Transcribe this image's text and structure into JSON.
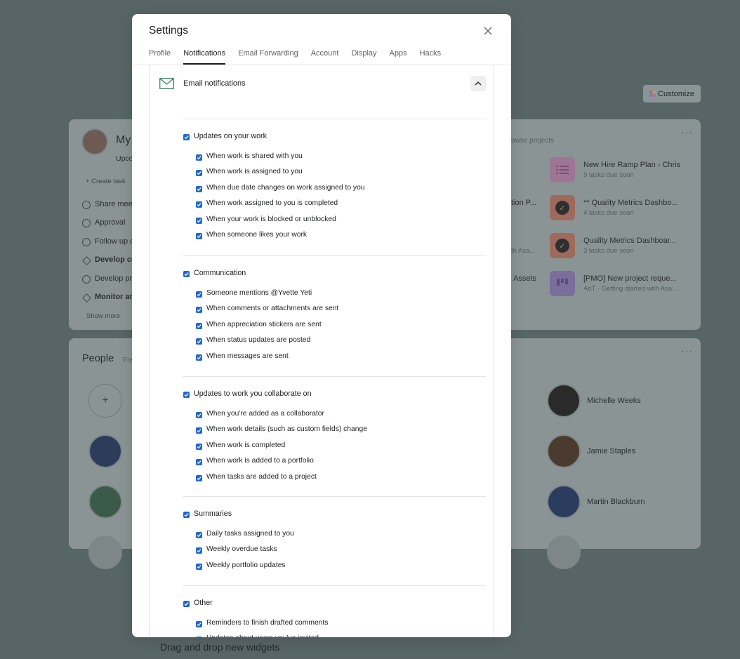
{
  "background": {
    "customize_label": "Customize",
    "my_title": "My",
    "my_tab": "Upco",
    "create_task": "Create task",
    "tasks": [
      "Share mee",
      "Approval",
      "Follow up c",
      "Develop co",
      "Develop pr",
      "Monitor an"
    ],
    "show_more": "Show more",
    "browse_projects": "owse projects",
    "projects": [
      {
        "name": "New Hire Ramp Plan - Chris",
        "sub": "9 tasks due soon",
        "color": "#9e7594"
      },
      {
        "name": "** Quality Metrics Dashbo...",
        "sub": "4 tasks due soon",
        "color": "#9e6a5c"
      },
      {
        "name": "Quality Metrics Dashboar...",
        "sub": "3 tasks due soon",
        "color": "#9e6a5c"
      },
      {
        "name": "[PMO] New project reque...",
        "sub": "AoT - Getting started with Asa...",
        "color": "#7b6d9c"
      }
    ],
    "partial_projects": [
      "tion P...",
      "th Asa...",
      "Assets"
    ],
    "people_title": "People",
    "people_sub": "Fre",
    "people": [
      "Michelle Weeks",
      "Jamie Staples",
      "Martin Blackburn"
    ],
    "bottom_hint": "Drag and drop new widgets"
  },
  "modal": {
    "title": "Settings",
    "tabs": [
      "Profile",
      "Notifications",
      "Email Forwarding",
      "Account",
      "Display",
      "Apps",
      "Hacks"
    ],
    "active_tab": "Notifications",
    "panel_title": "Email notifications",
    "groups": [
      {
        "label": "Updates on your work",
        "items": [
          "When work is shared with you",
          "When work is assigned to you",
          "When due date changes on work assigned to you",
          "When work assigned to you is completed",
          "When your work is blocked or unblocked",
          "When someone likes your work"
        ]
      },
      {
        "label": "Communication",
        "items": [
          "Someone mentions @Yvette Yeti",
          "When comments or attachments are sent",
          "When appreciation stickers are sent",
          "When status updates are posted",
          "When messages are sent"
        ]
      },
      {
        "label": "Updates to work you collaborate on",
        "items": [
          "When you're added as a collaborator",
          "When work details (such as custom fields) change",
          "When work is completed",
          "When work is added to a portfolio",
          "When tasks are added to a project"
        ]
      },
      {
        "label": "Summaries",
        "items": [
          "Daily tasks assigned to you",
          "Weekly overdue tasks",
          "Weekly portfolio updates"
        ]
      },
      {
        "label": "Other",
        "items": [
          "Reminders to finish drafted comments",
          "Updates about users you've invited"
        ]
      }
    ]
  },
  "colors": {
    "checkbox": "#1f67d2",
    "overlay_background": "#586566"
  }
}
